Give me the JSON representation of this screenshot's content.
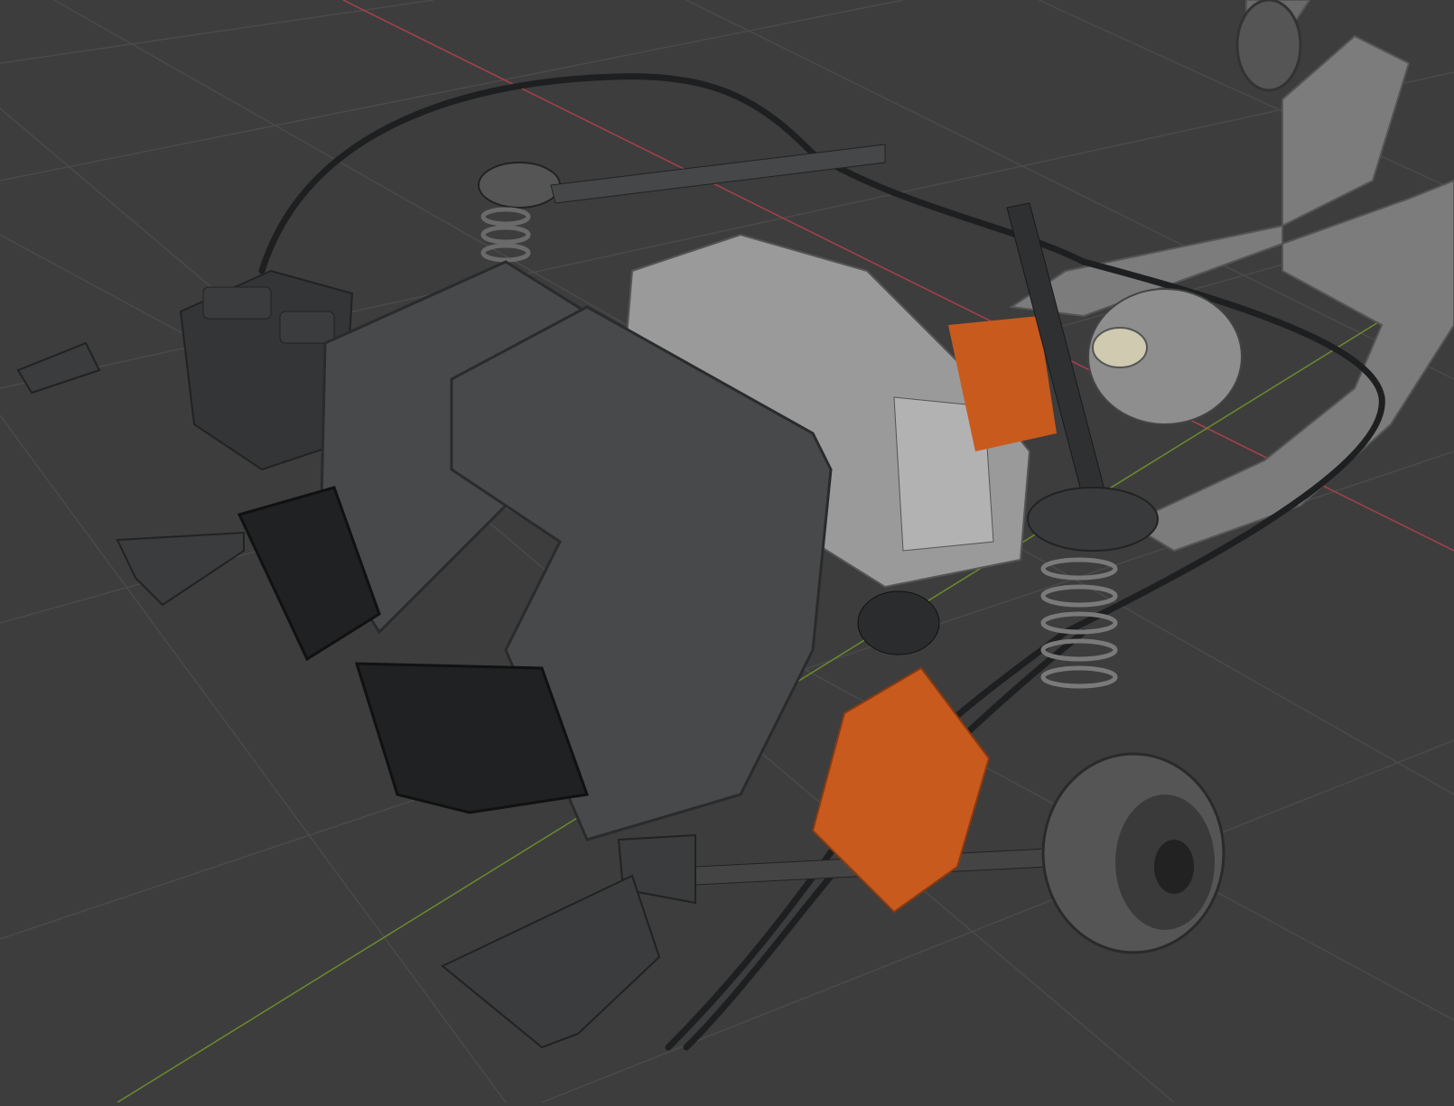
{
  "viewport": {
    "colors": {
      "background": "#3d3d3d",
      "grid": "#4a4a4a",
      "axis_x": "#a8404a",
      "axis_y": "#6c8a2e",
      "rubber": "#2e3031",
      "housing": "#47494b",
      "metal": "#9a9a9a",
      "orange": "#c85a1e",
      "frame": "#7c7c7c"
    }
  }
}
